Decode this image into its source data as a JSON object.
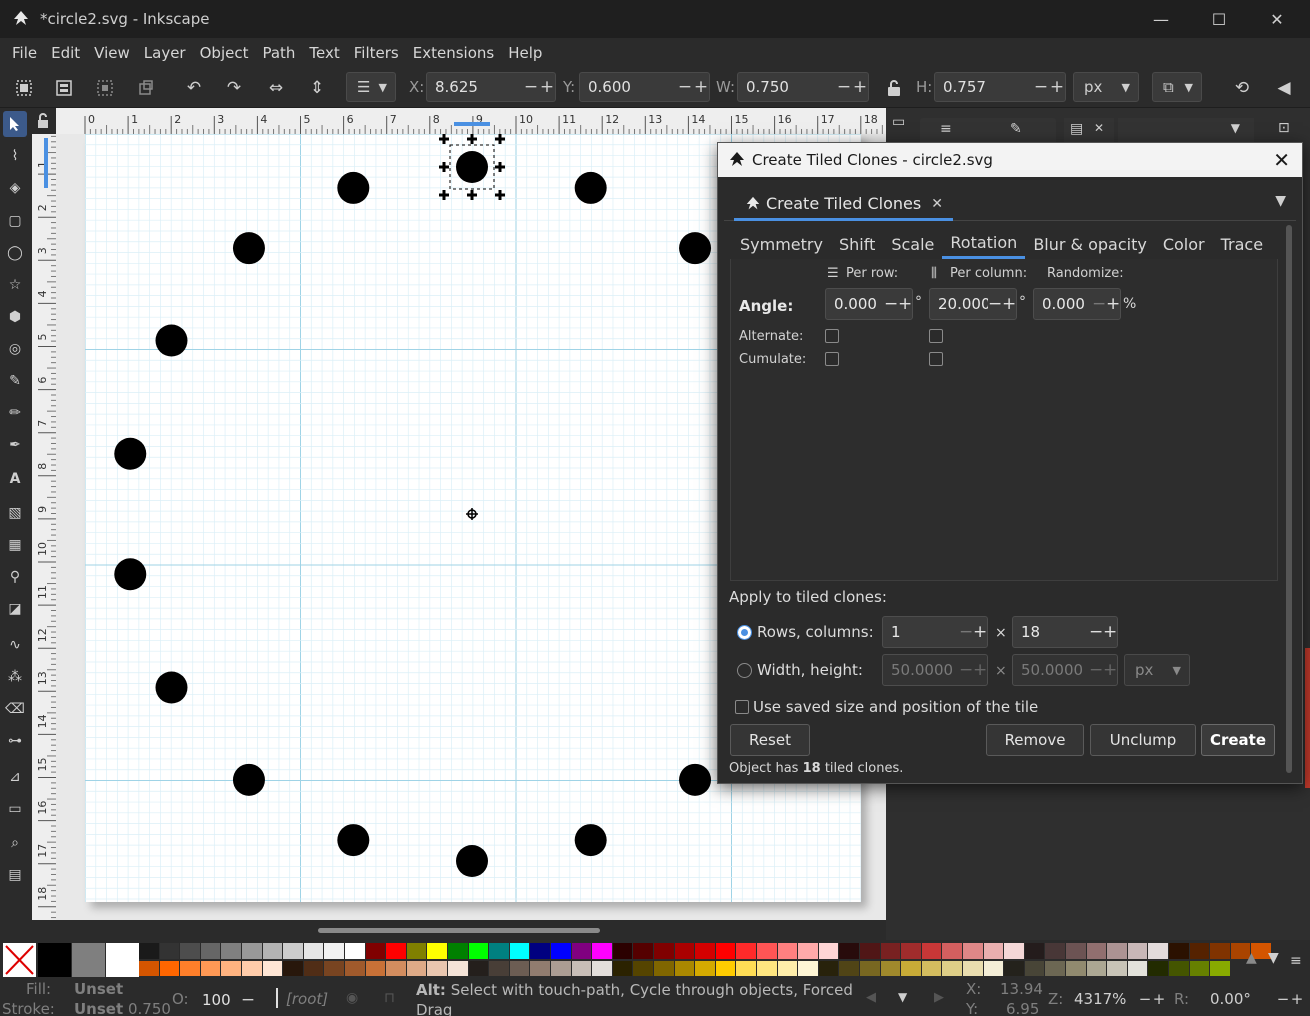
{
  "window": {
    "title": "*circle2.svg - Inkscape",
    "minimize": "—",
    "maximize": "☐",
    "close": "✕"
  },
  "menu": [
    "File",
    "Edit",
    "View",
    "Layer",
    "Object",
    "Path",
    "Text",
    "Filters",
    "Extensions",
    "Help"
  ],
  "toolbar": {
    "x_label": "X:",
    "x_value": "8.625",
    "y_label": "Y:",
    "y_value": "0.600",
    "w_label": "W:",
    "w_value": "0.750",
    "h_label": "H:",
    "h_value": "0.757",
    "unit": "px",
    "minus": "−",
    "plus": "+"
  },
  "ruler": {
    "top_labels": [
      "0",
      "1",
      "2",
      "3",
      "4",
      "5",
      "6",
      "7",
      "8",
      "9",
      "10",
      "11",
      "12",
      "13",
      "14",
      "15",
      "16",
      "17",
      "18"
    ],
    "left_labels": [
      "1",
      "2",
      "3",
      "4",
      "5",
      "6",
      "7",
      "8",
      "9",
      "10",
      "11",
      "12",
      "13",
      "14",
      "15",
      "16",
      "17",
      "18"
    ]
  },
  "dialog": {
    "title": "Create Tiled Clones - circle2.svg",
    "tab_label": "Create Tiled Clones",
    "tab_close": "✕",
    "subtabs": [
      "Symmetry",
      "Shift",
      "Scale",
      "Rotation",
      "Blur & opacity",
      "Color",
      "Trace"
    ],
    "active_subtab": "Rotation",
    "per_row": "Per row:",
    "per_column": "Per column:",
    "randomize": "Randomize:",
    "angle_label": "Angle:",
    "angle_per_row": "0.000",
    "angle_per_column": "20.000",
    "angle_randomize": "0.000",
    "degree": "°",
    "percent": "%",
    "alternate_label": "Alternate:",
    "cumulate_label": "Cumulate:",
    "apply_label": "Apply to tiled clones:",
    "rows_columns_label": "Rows, columns:",
    "rows_value": "1",
    "columns_value": "18",
    "times": "×",
    "width_height_label": "Width, height:",
    "width_value": "50.0000",
    "height_value": "50.0000",
    "wh_unit": "px",
    "use_saved_label": "Use saved size and position of the tile",
    "reset_button": "Reset",
    "remove_button": "Remove",
    "unclump_button": "Unclump",
    "create_button": "Create",
    "status_prefix": "Object has ",
    "status_count": "18",
    "status_suffix": " tiled clones."
  },
  "status": {
    "fill_label": "Fill:",
    "fill_value": "Unset",
    "stroke_label": "Stroke:",
    "stroke_value": "Unset",
    "stroke_width": "0.750",
    "opacity_label": "O:",
    "opacity_value": "100",
    "layer": "[root]",
    "message_bold": "Alt:",
    "message": " Select with touch-path, Cycle through objects, Forced Drag",
    "x_label": "X:",
    "x_value": "13.94",
    "y_label": "Y:",
    "y_value": "6.95",
    "zoom_label": "Z:",
    "zoom_value": "4317%",
    "rotate_label": "R:",
    "rotate_value": "0.00°"
  },
  "colors": {
    "accent": "#4a90e2",
    "palette_row1": [
      "#000000",
      "#7f7f7f",
      "#ffffff",
      "#1a1a1a",
      "#333333",
      "#4d4d4d",
      "#666666",
      "#808080",
      "#999999",
      "#b3b3b3",
      "#cccccc",
      "#e6e6e6",
      "#f2f2f2",
      "#ffffff",
      "#800000",
      "#ff0000",
      "#808000",
      "#ffff00",
      "#008000",
      "#00ff00",
      "#008080",
      "#00ffff",
      "#000080",
      "#0000ff",
      "#800080",
      "#ff00ff",
      "#2b0000",
      "#550000",
      "#800000",
      "#aa0000",
      "#d40000",
      "#ff0000",
      "#ff2a2a",
      "#ff5555",
      "#ff8080",
      "#ffaaaa",
      "#ffd5d5",
      "#280b0b",
      "#501616",
      "#782121",
      "#a02c2c",
      "#c83737",
      "#d35f5f",
      "#de8787",
      "#e9afaf",
      "#f4d7d7",
      "#241c1c",
      "#483737",
      "#6c5353",
      "#916f6f",
      "#ac9393",
      "#c8b7b7",
      "#e3dbdb",
      "#2b1100",
      "#552200",
      "#803300",
      "#aa4400",
      "#d45500"
    ],
    "palette_row2": [
      "#d45500",
      "#ff6600",
      "#ff7f2a",
      "#ff9955",
      "#ffb380",
      "#ffccaa",
      "#ffe6d5",
      "#28170b",
      "#502d16",
      "#784421",
      "#a05a2c",
      "#c87137",
      "#d38d5f",
      "#deaa87",
      "#e9c6af",
      "#f4e3d7",
      "#241f1c",
      "#483e37",
      "#6c5d53",
      "#917c6f",
      "#ac9d93",
      "#c8beb7",
      "#e3dedb",
      "#2b2200",
      "#554400",
      "#806600",
      "#aa8800",
      "#d4aa00",
      "#ffcc00",
      "#ffdd55",
      "#ffe680",
      "#ffeeaa",
      "#fff6d5",
      "#28220b",
      "#504416",
      "#786721",
      "#a0892c",
      "#c8ab37",
      "#d4bd5f",
      "#dece87",
      "#e9ddaf",
      "#f4eed7",
      "#24221c",
      "#484537",
      "#6c6753",
      "#918a6f",
      "#aca793",
      "#c8c4b7",
      "#e3e2db",
      "#222b00",
      "#445500",
      "#668000",
      "#88aa00"
    ]
  },
  "icons": {
    "app": "inkscape-logo-icon",
    "lock": "lock-icon",
    "dialog_more": "chevron-down-icon"
  }
}
